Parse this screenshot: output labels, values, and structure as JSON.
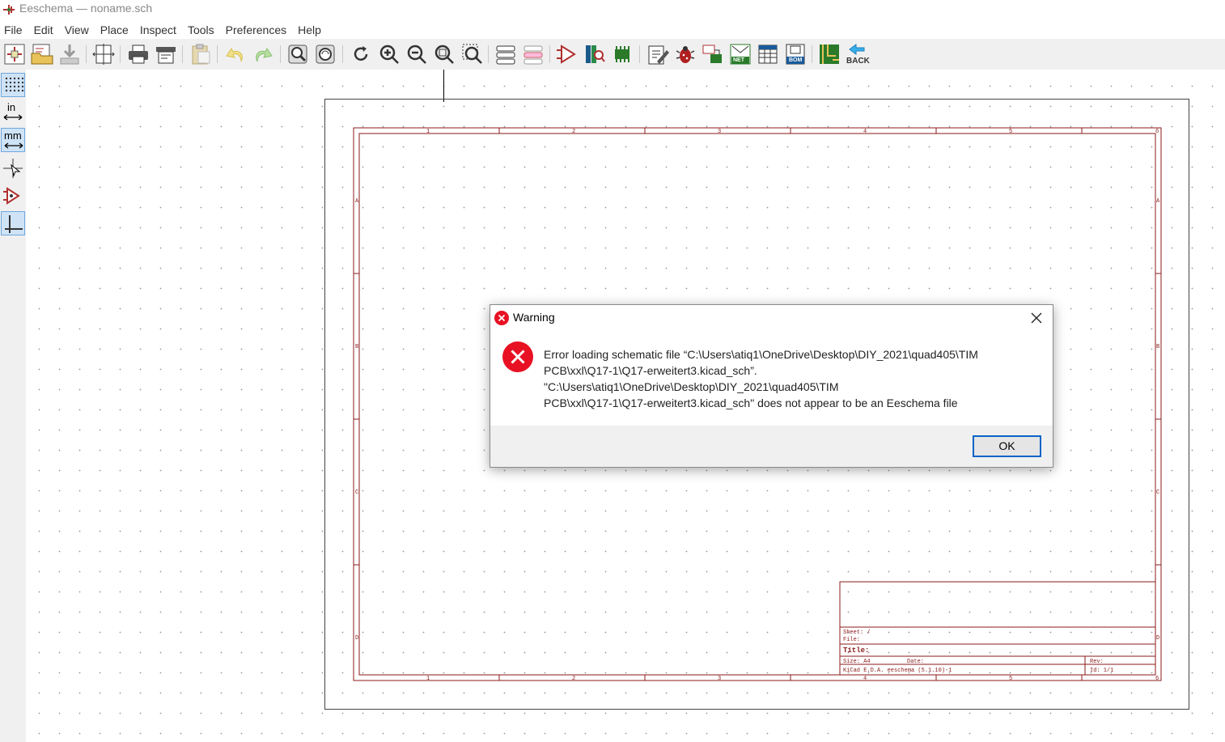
{
  "window": {
    "title": "Eeschema — noname.sch"
  },
  "menu": [
    "File",
    "Edit",
    "View",
    "Place",
    "Inspect",
    "Tools",
    "Preferences",
    "Help"
  ],
  "toolbar": {
    "buttons": [
      "new-schematic",
      "open-schematic",
      "save",
      "page-settings",
      "print",
      "plot",
      "paste",
      "undo",
      "redo",
      "find",
      "find-replace",
      "refresh",
      "zoom-in",
      "zoom-out",
      "zoom-fit",
      "zoom-selection",
      "hierarchy-navigator",
      "leave-sheet",
      "symbol-editor",
      "symbol-library-browser",
      "footprint-editor",
      "annotate",
      "erc",
      "assign-footprints",
      "netlist",
      "bom-table",
      "bom",
      "pcbnew"
    ],
    "back_label": "BACK",
    "net_label": "NET",
    "bom_label": "BOM"
  },
  "left_toolbar": {
    "buttons": [
      "grid-toggle",
      "units-inch",
      "units-mm",
      "cursor-shape",
      "hidden-pins",
      "bus-wire-45"
    ],
    "inch_label": "in",
    "mm_label": "mm",
    "active": [
      "grid-toggle",
      "units-mm",
      "bus-wire-45"
    ]
  },
  "sheet": {
    "col_labels": [
      "1",
      "2",
      "3",
      "4",
      "5",
      "6"
    ],
    "row_labels": [
      "A",
      "B",
      "C",
      "D"
    ],
    "title_block": {
      "sheet": "Sheet: /",
      "file": "File:",
      "title": "Title:",
      "size": "Size: A4",
      "date": "Date:",
      "rev": "Rev:",
      "kicad": "KiCad E.D.A.  eeschema (5.1.10)-1",
      "id": "Id: 1/1"
    }
  },
  "dialog": {
    "title": "Warning",
    "message_lines": [
      "Error loading schematic file “C:\\Users\\atiq1\\OneDrive\\Desktop\\DIY_2021\\quad405\\TIM",
      "PCB\\xxl\\Q17-1\\Q17-erweitert3.kicad_sch”.",
      "\"C:\\Users\\atiq1\\OneDrive\\Desktop\\DIY_2021\\quad405\\TIM",
      "PCB\\xxl\\Q17-1\\Q17-erweitert3.kicad_sch\" does not appear to be an Eeschema file"
    ],
    "ok_label": "OK"
  },
  "colors": {
    "sheet_border": "#8b1a1a",
    "error_red": "#e81123",
    "ok_border": "#0a64c8",
    "toolbar_bg": "#f0f0f0"
  }
}
